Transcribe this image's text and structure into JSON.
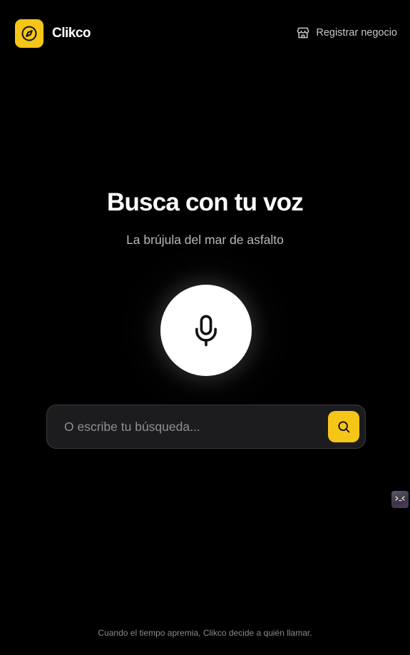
{
  "header": {
    "brand_name": "Clikco",
    "logo_icon": "compass-icon",
    "register_label": "Registrar negocio",
    "register_icon": "store-icon"
  },
  "hero": {
    "title": "Busca con tu voz",
    "subtitle": "La brújula del mar de asfalto"
  },
  "voice": {
    "mic_icon": "microphone-icon"
  },
  "search": {
    "placeholder": "O escribe tu búsqueda...",
    "value": "",
    "button_icon": "search-icon"
  },
  "footer": {
    "text": "Cuando el tiempo apremia, Clikco decide a quién llamar."
  },
  "colors": {
    "background": "#000000",
    "accent": "#f5c518",
    "text_primary": "#ffffff",
    "text_secondary": "#b9b9b9",
    "input_background": "#1c1c1e"
  }
}
